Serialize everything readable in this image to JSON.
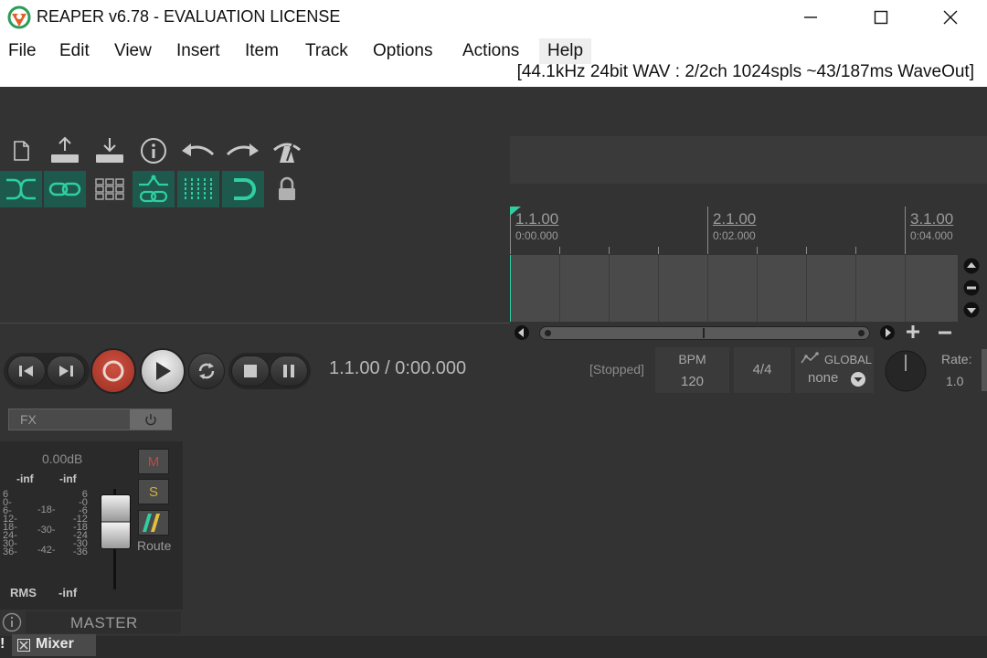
{
  "window": {
    "title": "REAPER v6.78 - EVALUATION LICENSE",
    "minimize_icon": "minimize-icon",
    "maximize_icon": "maximize-icon",
    "close_icon": "close-icon"
  },
  "menu": {
    "items": [
      "File",
      "Edit",
      "View",
      "Insert",
      "Item",
      "Track",
      "Options",
      "Actions",
      "Help"
    ],
    "hovered": "Help"
  },
  "audio_status": "[44.1kHz 24bit WAV : 2/2ch 1024spls ~43/187ms WaveOut]",
  "toolbar": {
    "row1": [
      "new-project-icon",
      "save-project-icon",
      "load-project-icon",
      "info-icon",
      "undo-icon",
      "redo-icon",
      "metronome-icon"
    ],
    "row2": [
      "crossfade-icon",
      "link-icon",
      "grid-icon",
      "envelope-link-icon",
      "snap-grid-icon",
      "snap-magnet-icon",
      "lock-icon"
    ],
    "accent": "#1d5a4d",
    "icon_green": "#2fcf9f"
  },
  "ruler": {
    "markers": [
      {
        "bar": "1.1.00",
        "time": "0:00.000"
      },
      {
        "bar": "2.1.00",
        "time": "0:02.000"
      },
      {
        "bar": "3.1.00",
        "time": "0:04.000"
      }
    ]
  },
  "transport": {
    "buttons": [
      "skip-start-icon",
      "skip-end-icon",
      "record-icon",
      "play-icon",
      "repeat-icon",
      "stop-icon",
      "pause-icon"
    ],
    "position": "1.1.00 / 0:00.000",
    "state": "[Stopped]",
    "bpm_label": "BPM",
    "bpm_value": "120",
    "time_signature": "4/4",
    "global_label": "GLOBAL",
    "global_value": "none",
    "rate_label": "Rate:",
    "rate_value": "1.0",
    "record_color": "#b43c2c"
  },
  "fx": {
    "label": "FX"
  },
  "master": {
    "volume_db": "0.00dB",
    "peak_left": "-inf",
    "peak_right": "-inf",
    "scale_left": [
      "6",
      "0-",
      "6-",
      "12-",
      "18-",
      "24-",
      "30-",
      "36-"
    ],
    "scale_mid": [
      "-18-",
      "-30-",
      "-42-"
    ],
    "scale_right": [
      "6",
      "-0",
      "-6",
      "-12",
      "-18",
      "-24",
      "-30",
      "-36"
    ],
    "mute_label": "M",
    "solo_label": "S",
    "route_label": "Route",
    "rms_label": "RMS",
    "rms_value": "-inf",
    "name": "MASTER"
  },
  "bottom": {
    "warning_label": "!",
    "mixer_tab_label": "Mixer"
  }
}
